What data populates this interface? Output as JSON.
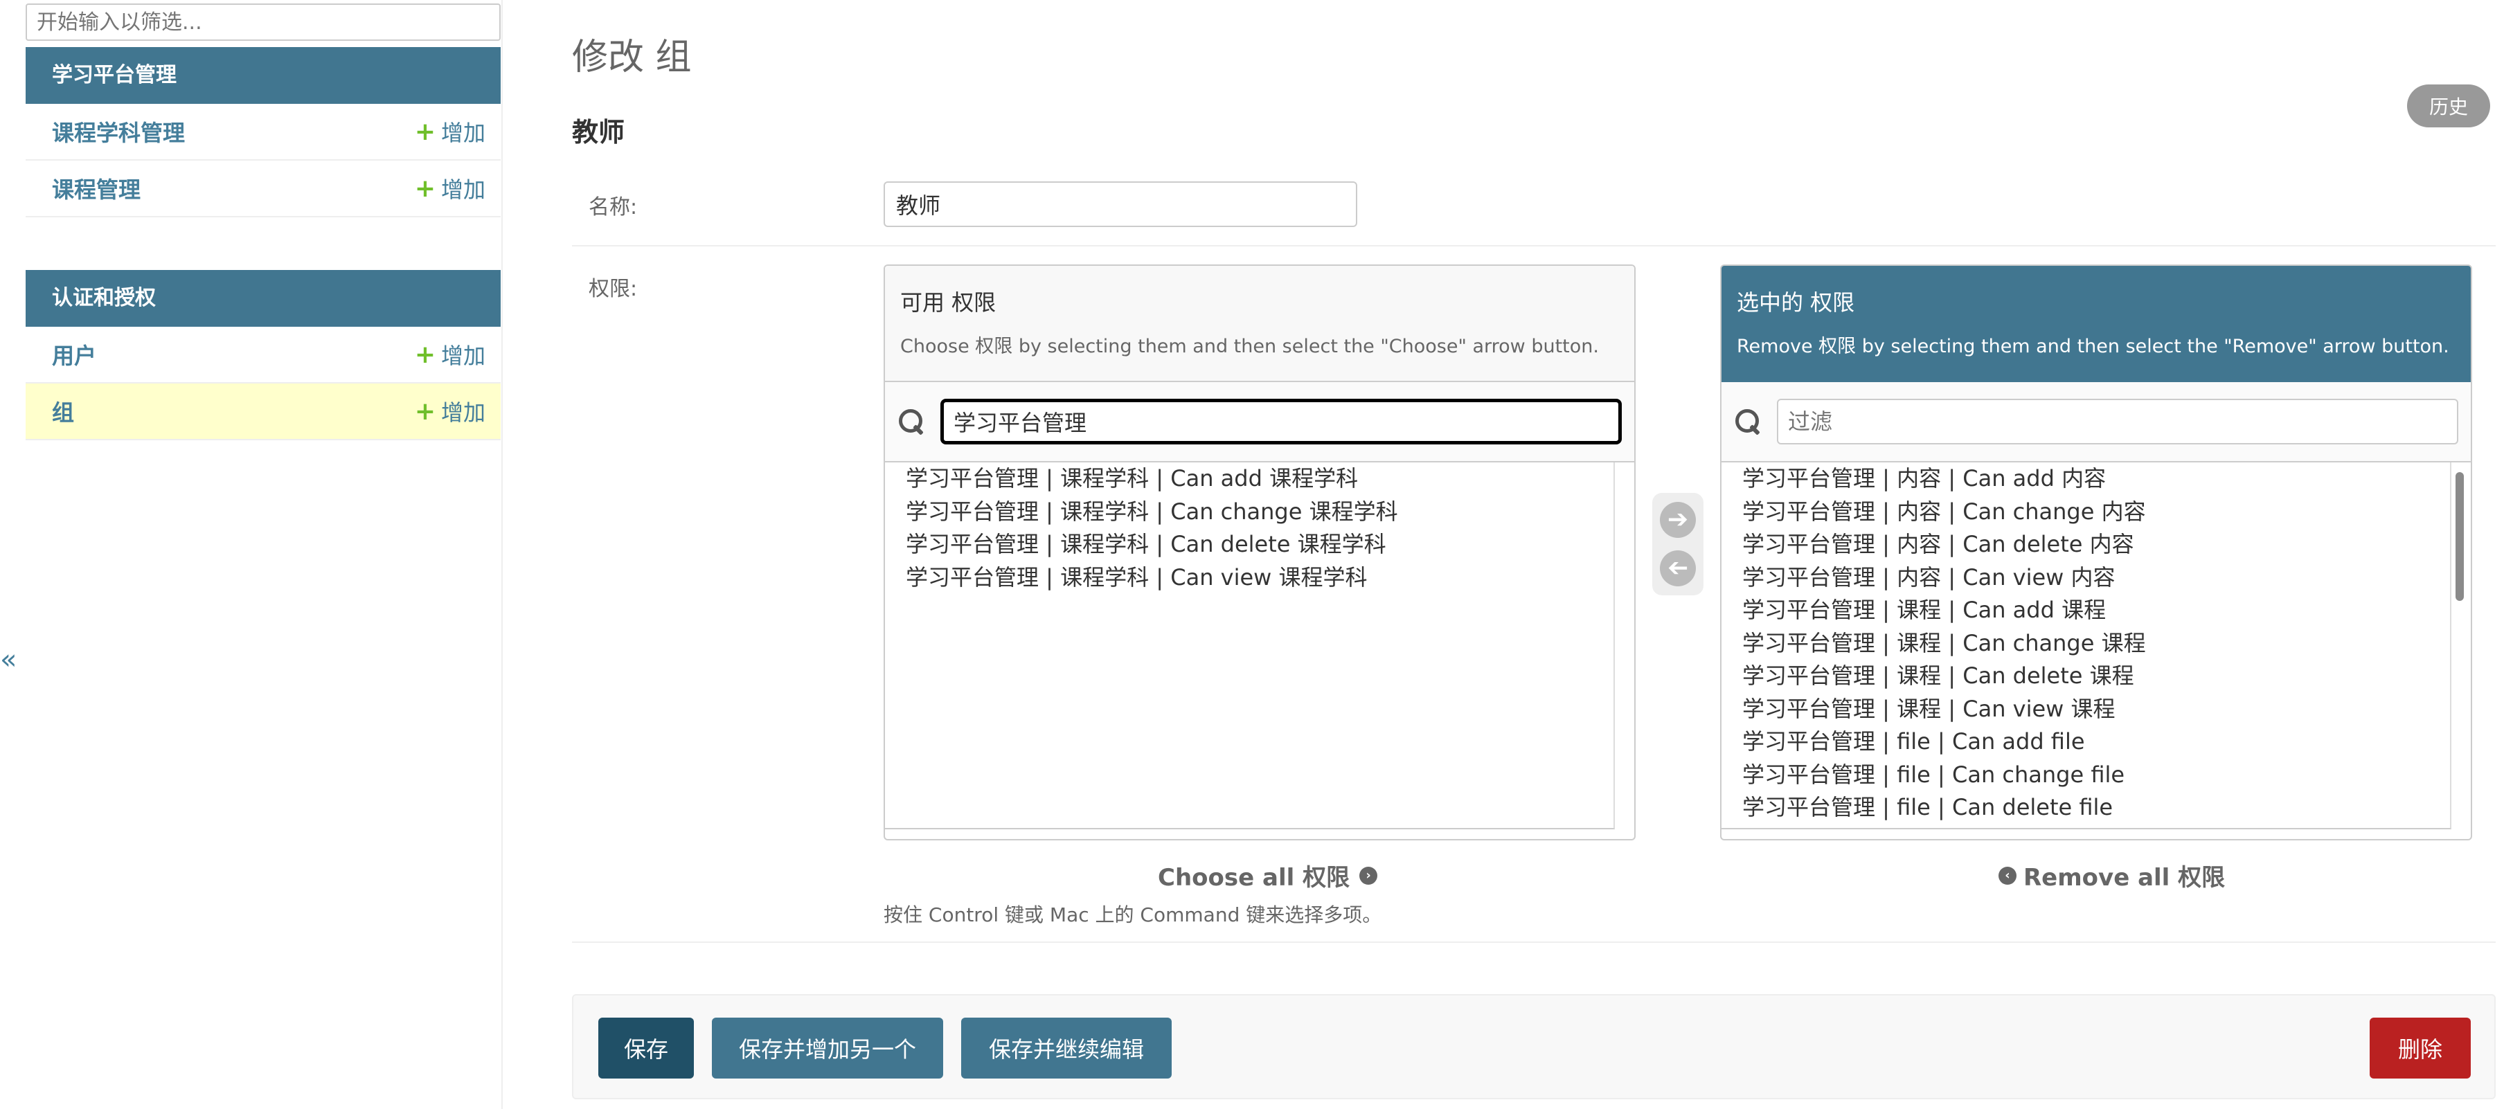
{
  "sidebar": {
    "filter_placeholder": "开始输入以筛选...",
    "collapse_symbol": "«",
    "modules": [
      {
        "caption": "学习平台管理",
        "rows": [
          {
            "label": "课程学科管理",
            "add_label": "增加"
          },
          {
            "label": "课程管理",
            "add_label": "增加"
          }
        ]
      },
      {
        "caption": "认证和授权",
        "rows": [
          {
            "label": "用户",
            "add_label": "增加"
          },
          {
            "label": "组",
            "add_label": "增加",
            "current": true
          }
        ]
      }
    ]
  },
  "header": {
    "title": "修改 组",
    "object_name": "教师",
    "history_label": "历史"
  },
  "form": {
    "name_label": "名称:",
    "name_value": "教师",
    "permissions_label": "权限:",
    "available": {
      "title": "可用 权限",
      "help": "Choose 权限 by selecting them and then select the \"Choose\" arrow button.",
      "filter_value": "学习平台管理",
      "items": [
        "学习平台管理 | 课程学科 | Can add 课程学科",
        "学习平台管理 | 课程学科 | Can change 课程学科",
        "学习平台管理 | 课程学科 | Can delete 课程学科",
        "学习平台管理 | 课程学科 | Can view 课程学科"
      ],
      "choose_all_label": "Choose all 权限"
    },
    "chosen": {
      "title": "选中的 权限",
      "help": "Remove 权限 by selecting them and then select the \"Remove\" arrow button.",
      "filter_placeholder": "过滤",
      "items": [
        "学习平台管理 | 内容 | Can add 内容",
        "学习平台管理 | 内容 | Can change 内容",
        "学习平台管理 | 内容 | Can delete 内容",
        "学习平台管理 | 内容 | Can view 内容",
        "学习平台管理 | 课程 | Can add 课程",
        "学习平台管理 | 课程 | Can change 课程",
        "学习平台管理 | 课程 | Can delete 课程",
        "学习平台管理 | 课程 | Can view 课程",
        "学习平台管理 | file | Can add file",
        "学习平台管理 | file | Can change file",
        "学习平台管理 | file | Can delete file"
      ],
      "remove_all_label": "Remove all 权限"
    },
    "help_text": "按住 Control 键或 Mac 上的 Command 键来选择多项。"
  },
  "submit_row": {
    "save": "保存",
    "save_add": "保存并增加另一个",
    "save_continue": "保存并继续编辑",
    "delete": "删除"
  },
  "colors": {
    "header_blue": "#417690",
    "dark_blue": "#205067",
    "link_blue": "#447e9b",
    "add_green": "#70bf2b",
    "delete_red": "#ba2121",
    "current_row": "#ffffcc"
  }
}
